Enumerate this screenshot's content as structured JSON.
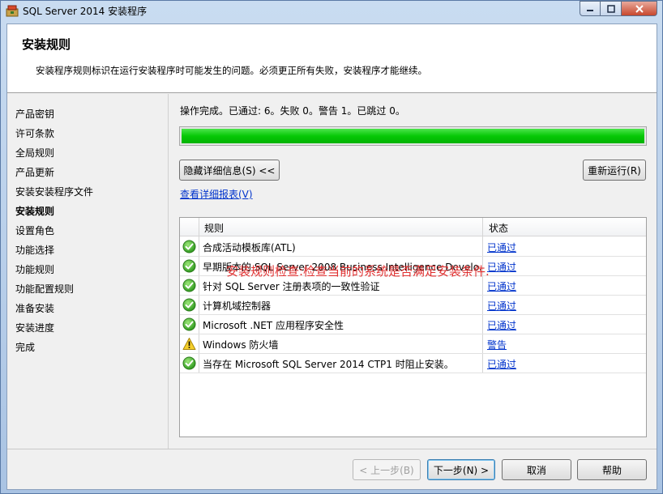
{
  "window": {
    "title": "SQL Server 2014 安装程序"
  },
  "header": {
    "title": "安装规则",
    "description": "安装程序规则标识在运行安装程序时可能发生的问题。必须更正所有失败，安装程序才能继续。"
  },
  "sidebar": {
    "items": [
      {
        "label": "产品密钥",
        "active": false
      },
      {
        "label": "许可条款",
        "active": false
      },
      {
        "label": "全局规则",
        "active": false
      },
      {
        "label": "产品更新",
        "active": false
      },
      {
        "label": "安装安装程序文件",
        "active": false
      },
      {
        "label": "安装规则",
        "active": true
      },
      {
        "label": "设置角色",
        "active": false
      },
      {
        "label": "功能选择",
        "active": false
      },
      {
        "label": "功能规则",
        "active": false
      },
      {
        "label": "功能配置规则",
        "active": false
      },
      {
        "label": "准备安装",
        "active": false
      },
      {
        "label": "安装进度",
        "active": false
      },
      {
        "label": "完成",
        "active": false
      }
    ]
  },
  "main": {
    "status_text": "操作完成。已通过: 6。失败 0。警告 1。已跳过 0。",
    "progress": 1.0,
    "hide_details_label": "隐藏详细信息(S) <<",
    "rerun_label": "重新运行(R)",
    "report_link": "查看详细报表(V)",
    "table": {
      "columns": [
        "规则",
        "状态"
      ],
      "rows": [
        {
          "icon": "check-circle-icon",
          "rule": "合成活动模板库(ATL)",
          "status": "已通过"
        },
        {
          "icon": "check-circle-icon",
          "rule": "早期版本的 SQL Server 2008 Business Intelligence Develo...",
          "status": "已通过"
        },
        {
          "icon": "check-circle-icon",
          "rule": "针对 SQL Server 注册表项的一致性验证",
          "status": "已通过"
        },
        {
          "icon": "check-circle-icon",
          "rule": "计算机域控制器",
          "status": "已通过"
        },
        {
          "icon": "check-circle-icon",
          "rule": "Microsoft .NET 应用程序安全性",
          "status": "已通过"
        },
        {
          "icon": "warning-icon",
          "rule": "Windows 防火墙",
          "status": "警告"
        },
        {
          "icon": "check-circle-icon",
          "rule": "当存在 Microsoft SQL Server 2014 CTP1 时阻止安装。",
          "status": "已通过"
        }
      ]
    },
    "annotation": "安装规则检查:检查当前的系统是否满足安装条件."
  },
  "footer": {
    "back_label": "< 上一步(B)",
    "next_label": "下一步(N) >",
    "cancel_label": "取消",
    "help_label": "帮助"
  },
  "colors": {
    "progress_green": "#06c806",
    "link_blue": "#0033cc",
    "annotation_red": "#e03030"
  }
}
